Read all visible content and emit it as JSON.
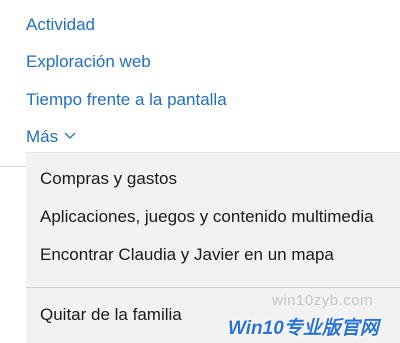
{
  "nav": {
    "activity": "Actividad",
    "web_browsing": "Exploración web",
    "screen_time": "Tiempo frente a la pantalla",
    "more": "Más"
  },
  "menu": {
    "items": [
      "Compras y gastos",
      "Aplicaciones, juegos y contenido multimedia",
      "Encontrar Claudia y Javier en un mapa",
      "Quitar de la familia"
    ]
  },
  "watermark": {
    "url": "win10zyb.com",
    "logo": "Win10专业版官网"
  },
  "colors": {
    "link": "#1f6fc4",
    "menu_bg": "#f2f2f2",
    "text": "#1a1a1a"
  },
  "icons": {
    "more_chevron": "chevron-down-icon"
  }
}
